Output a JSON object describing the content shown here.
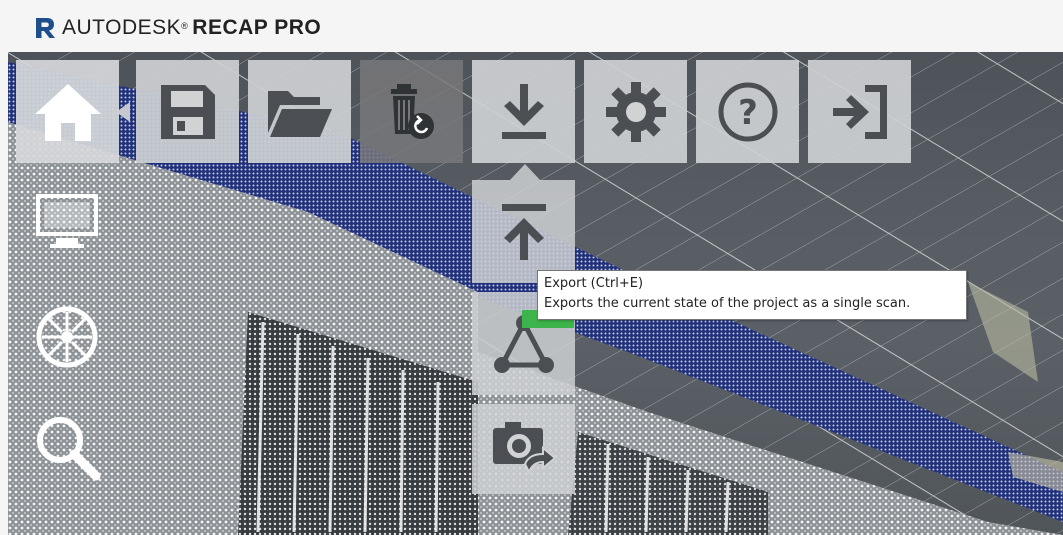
{
  "app": {
    "brand": "AUTODESK",
    "trademark": "®",
    "product": "RECAP PRO",
    "logo_letter": "R"
  },
  "toolbar": {
    "buttons": [
      {
        "name": "home",
        "icon": "home-icon"
      },
      {
        "name": "save",
        "icon": "floppy-disk-icon"
      },
      {
        "name": "open",
        "icon": "folder-open-icon"
      },
      {
        "name": "recycle-bin",
        "icon": "trash-restore-icon"
      },
      {
        "name": "export",
        "icon": "download-arrow-icon"
      },
      {
        "name": "settings",
        "icon": "gear-icon"
      },
      {
        "name": "help",
        "icon": "question-circle-icon"
      },
      {
        "name": "exit",
        "icon": "sign-out-icon"
      }
    ]
  },
  "export_menu": {
    "items": [
      {
        "name": "export-upload",
        "icon": "upload-arrow-icon"
      },
      {
        "name": "export-mesh",
        "icon": "mesh-nodes-icon"
      },
      {
        "name": "export-snapshot",
        "icon": "camera-export-icon"
      }
    ]
  },
  "tooltip": {
    "title": "Export (Ctrl+E)",
    "description": "Exports the current state of the project as a single scan."
  },
  "colors": {
    "accent_green": "#3cb44b",
    "brand_blue": "#1f4e8c",
    "icon_dark": "#4b4f53",
    "icon_white": "#ffffff"
  }
}
